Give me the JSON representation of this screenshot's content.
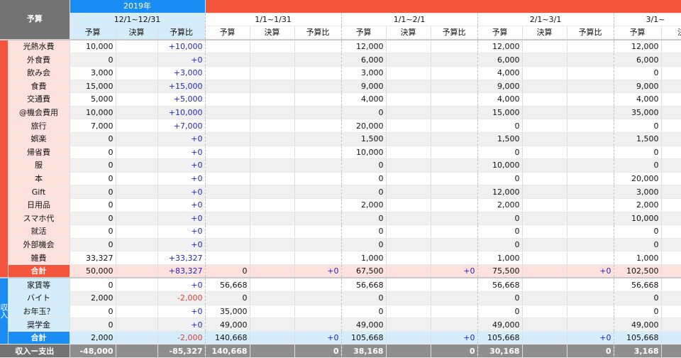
{
  "header": {
    "corner_label": "予算",
    "year_2019": "2019年",
    "year_2020": "",
    "periods": [
      "12/1~12/31",
      "1/1~1/31",
      "1/1~2/1",
      "2/1~3/1",
      "3/1~"
    ],
    "sub_budget": "予算",
    "sub_actual": "決算",
    "sub_ratio": "予算比"
  },
  "sections": {
    "income_sidebar": "収入"
  },
  "expense_rows": [
    {
      "label": "光熱水費",
      "p0": [
        "10,000",
        "",
        "+10,000"
      ],
      "p1": [
        "",
        "",
        ""
      ],
      "p2": [
        "12,000",
        "",
        ""
      ],
      "p3": [
        "12,000",
        "",
        ""
      ],
      "p4": [
        "12,000",
        ""
      ]
    },
    {
      "label": "外食費",
      "p0": [
        "0",
        "",
        "+0"
      ],
      "p1": [
        "",
        "",
        ""
      ],
      "p2": [
        "6,000",
        "",
        ""
      ],
      "p3": [
        "6,000",
        "",
        ""
      ],
      "p4": [
        "6,000",
        ""
      ]
    },
    {
      "label": "飲み会",
      "p0": [
        "3,000",
        "",
        "+3,000"
      ],
      "p1": [
        "",
        "",
        ""
      ],
      "p2": [
        "3,000",
        "",
        ""
      ],
      "p3": [
        "4,000",
        "",
        ""
      ],
      "p4": [
        "0",
        ""
      ]
    },
    {
      "label": "食費",
      "p0": [
        "15,000",
        "",
        "+15,000"
      ],
      "p1": [
        "",
        "",
        ""
      ],
      "p2": [
        "9,000",
        "",
        ""
      ],
      "p3": [
        "9,000",
        "",
        ""
      ],
      "p4": [
        "9,000",
        ""
      ]
    },
    {
      "label": "交通費",
      "p0": [
        "5,000",
        "",
        "+5,000"
      ],
      "p1": [
        "",
        "",
        ""
      ],
      "p2": [
        "4,000",
        "",
        ""
      ],
      "p3": [
        "4,000",
        "",
        ""
      ],
      "p4": [
        "4,000",
        ""
      ]
    },
    {
      "label": "@機会費用",
      "p0": [
        "10,000",
        "",
        "+10,000"
      ],
      "p1": [
        "",
        "",
        ""
      ],
      "p2": [
        "0",
        "",
        ""
      ],
      "p3": [
        "15,000",
        "",
        ""
      ],
      "p4": [
        "35,000",
        ""
      ]
    },
    {
      "label": "旅行",
      "p0": [
        "7,000",
        "",
        "+7,000"
      ],
      "p1": [
        "",
        "",
        ""
      ],
      "p2": [
        "20,000",
        "",
        ""
      ],
      "p3": [
        "0",
        "",
        ""
      ],
      "p4": [
        "0",
        ""
      ]
    },
    {
      "label": "娯楽",
      "p0": [
        "0",
        "",
        "+0"
      ],
      "p1": [
        "",
        "",
        ""
      ],
      "p2": [
        "1,500",
        "",
        ""
      ],
      "p3": [
        "1,500",
        "",
        ""
      ],
      "p4": [
        "1,500",
        ""
      ]
    },
    {
      "label": "帰省費",
      "p0": [
        "0",
        "",
        "+0"
      ],
      "p1": [
        "",
        "",
        ""
      ],
      "p2": [
        "10,000",
        "",
        ""
      ],
      "p3": [
        "0",
        "",
        ""
      ],
      "p4": [
        "0",
        ""
      ]
    },
    {
      "label": "服",
      "p0": [
        "0",
        "",
        "+0"
      ],
      "p1": [
        "",
        "",
        ""
      ],
      "p2": [
        "0",
        "",
        ""
      ],
      "p3": [
        "10,000",
        "",
        ""
      ],
      "p4": [
        "0",
        ""
      ]
    },
    {
      "label": "本",
      "p0": [
        "0",
        "",
        "+0"
      ],
      "p1": [
        "",
        "",
        ""
      ],
      "p2": [
        "0",
        "",
        ""
      ],
      "p3": [
        "0",
        "",
        ""
      ],
      "p4": [
        "20,000",
        ""
      ]
    },
    {
      "label": "Gift",
      "p0": [
        "0",
        "",
        "+0"
      ],
      "p1": [
        "",
        "",
        ""
      ],
      "p2": [
        "0",
        "",
        ""
      ],
      "p3": [
        "12,000",
        "",
        ""
      ],
      "p4": [
        "3,000",
        ""
      ]
    },
    {
      "label": "日用品",
      "p0": [
        "0",
        "",
        "+0"
      ],
      "p1": [
        "",
        "",
        ""
      ],
      "p2": [
        "2,000",
        "",
        ""
      ],
      "p3": [
        "2,000",
        "",
        ""
      ],
      "p4": [
        "2,000",
        ""
      ]
    },
    {
      "label": "スマホ代",
      "p0": [
        "0",
        "",
        "+0"
      ],
      "p1": [
        "",
        "",
        ""
      ],
      "p2": [
        "0",
        "",
        ""
      ],
      "p3": [
        "0",
        "",
        ""
      ],
      "p4": [
        "10,000",
        ""
      ]
    },
    {
      "label": "就活",
      "p0": [
        "0",
        "",
        "+0"
      ],
      "p1": [
        "",
        "",
        ""
      ],
      "p2": [
        "0",
        "",
        ""
      ],
      "p3": [
        "0",
        "",
        ""
      ],
      "p4": [
        "0",
        ""
      ]
    },
    {
      "label": "外部機会",
      "p0": [
        "0",
        "",
        "+0"
      ],
      "p1": [
        "",
        "",
        ""
      ],
      "p2": [
        "0",
        "",
        ""
      ],
      "p3": [
        "0",
        "",
        ""
      ],
      "p4": [
        "0",
        ""
      ]
    },
    {
      "label": "雑費",
      "p0": [
        "33,327",
        "",
        "+33,327"
      ],
      "p1": [
        "",
        "",
        ""
      ],
      "p2": [
        "1,000",
        "",
        ""
      ],
      "p3": [
        "1,000",
        "",
        ""
      ],
      "p4": [
        "1,000",
        ""
      ]
    }
  ],
  "expense_total": {
    "label": "合計",
    "p0": [
      "50,000",
      "",
      "+83,327"
    ],
    "p1": [
      "0",
      "",
      "+0"
    ],
    "p2": [
      "67,500",
      "",
      "+0"
    ],
    "p3": [
      "75,500",
      "",
      "+0"
    ],
    "p4": [
      "102,500",
      ""
    ]
  },
  "income_rows": [
    {
      "label": "家賃等",
      "p0": [
        "0",
        "",
        "+0"
      ],
      "p1": [
        "56,668",
        "",
        ""
      ],
      "p2": [
        "56,668",
        "",
        ""
      ],
      "p3": [
        "56,668",
        "",
        ""
      ],
      "p4": [
        "56,668",
        ""
      ]
    },
    {
      "label": "バイト",
      "p0": [
        "2,000",
        "",
        "-2,000"
      ],
      "p1": [
        "0",
        "",
        ""
      ],
      "p2": [
        "0",
        "",
        ""
      ],
      "p3": [
        "0",
        "",
        ""
      ],
      "p4": [
        "0",
        ""
      ]
    },
    {
      "label": "お年玉？",
      "p0": [
        "0",
        "",
        "+0"
      ],
      "p1": [
        "35,000",
        "",
        ""
      ],
      "p2": [
        "0",
        "",
        ""
      ],
      "p3": [
        "0",
        "",
        ""
      ],
      "p4": [
        "0",
        ""
      ]
    },
    {
      "label": "奨学金",
      "p0": [
        "0",
        "",
        "+0"
      ],
      "p1": [
        "49,000",
        "",
        ""
      ],
      "p2": [
        "49,000",
        "",
        ""
      ],
      "p3": [
        "49,000",
        "",
        ""
      ],
      "p4": [
        "49,000",
        ""
      ]
    }
  ],
  "income_total": {
    "label": "合計",
    "p0": [
      "2,000",
      "",
      "-2,000"
    ],
    "p1": [
      "140,668",
      "",
      "+0"
    ],
    "p2": [
      "105,668",
      "",
      "+0"
    ],
    "p3": [
      "105,668",
      "",
      "+0"
    ],
    "p4": [
      "105,668",
      ""
    ]
  },
  "net_row": {
    "label": "収入ー支出",
    "p0": [
      "-48,000",
      "",
      "-85,327"
    ],
    "p1": [
      "140,668",
      "",
      "0"
    ],
    "p2": [
      "38,168",
      "",
      "0"
    ],
    "p3": [
      "30,168",
      "",
      "0"
    ],
    "p4": [
      "3,168",
      ""
    ]
  },
  "colors": {
    "expense_accent": "#f2553b",
    "income_accent": "#1a8df5",
    "positive_ratio": "#2323c8",
    "negative_value": "#e53b2c"
  }
}
